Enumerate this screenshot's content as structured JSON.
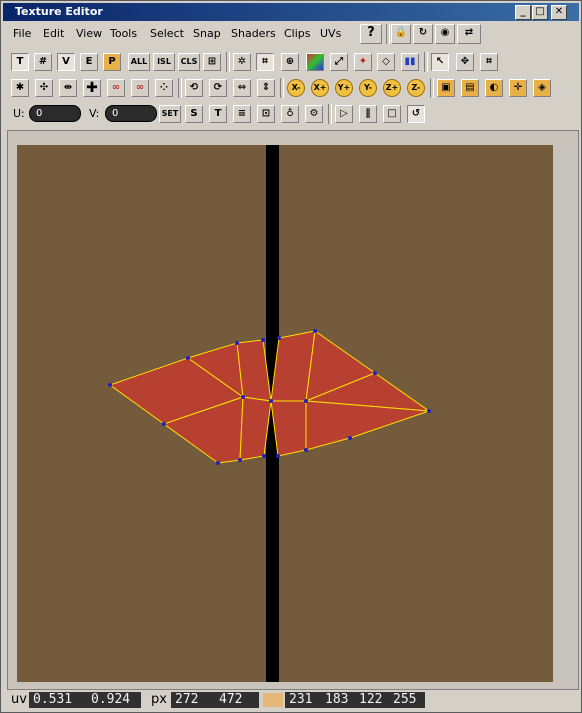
{
  "window": {
    "title": "Texture Editor",
    "controls": [
      "_",
      "□",
      "✕"
    ]
  },
  "menu": [
    "File",
    "Edit",
    "View",
    "Tools",
    "Select",
    "Snap",
    "Shaders",
    "Clips",
    "UVs"
  ],
  "toolbar1": {
    "left": [
      "T",
      "#",
      "V",
      "E",
      "P",
      "ALL",
      "ISL",
      "CLS"
    ],
    "right_labels": [
      "?"
    ]
  },
  "uv_fields": {
    "u_label": "U:",
    "u_value": "0",
    "v_label": "V:",
    "v_value": "0",
    "set_label": "SET"
  },
  "axis_buttons": [
    "X-",
    "X+",
    "Y+",
    "Y-",
    "Z+",
    "Z-"
  ],
  "status": {
    "uv_label": "uv",
    "u": "0.531",
    "v": "0.924",
    "px_label": "px",
    "px_x": "272",
    "px_y": "472",
    "color_r": "231",
    "color_g": "183",
    "color_b": "122",
    "color_a": "255",
    "swatch_color": "#e7b77a"
  },
  "colors": {
    "canvas": "#735b3b",
    "mesh_fill": "#b84030",
    "mesh_edge": "#ffe000",
    "vertex": "#2020c0",
    "seam": "#000000"
  }
}
